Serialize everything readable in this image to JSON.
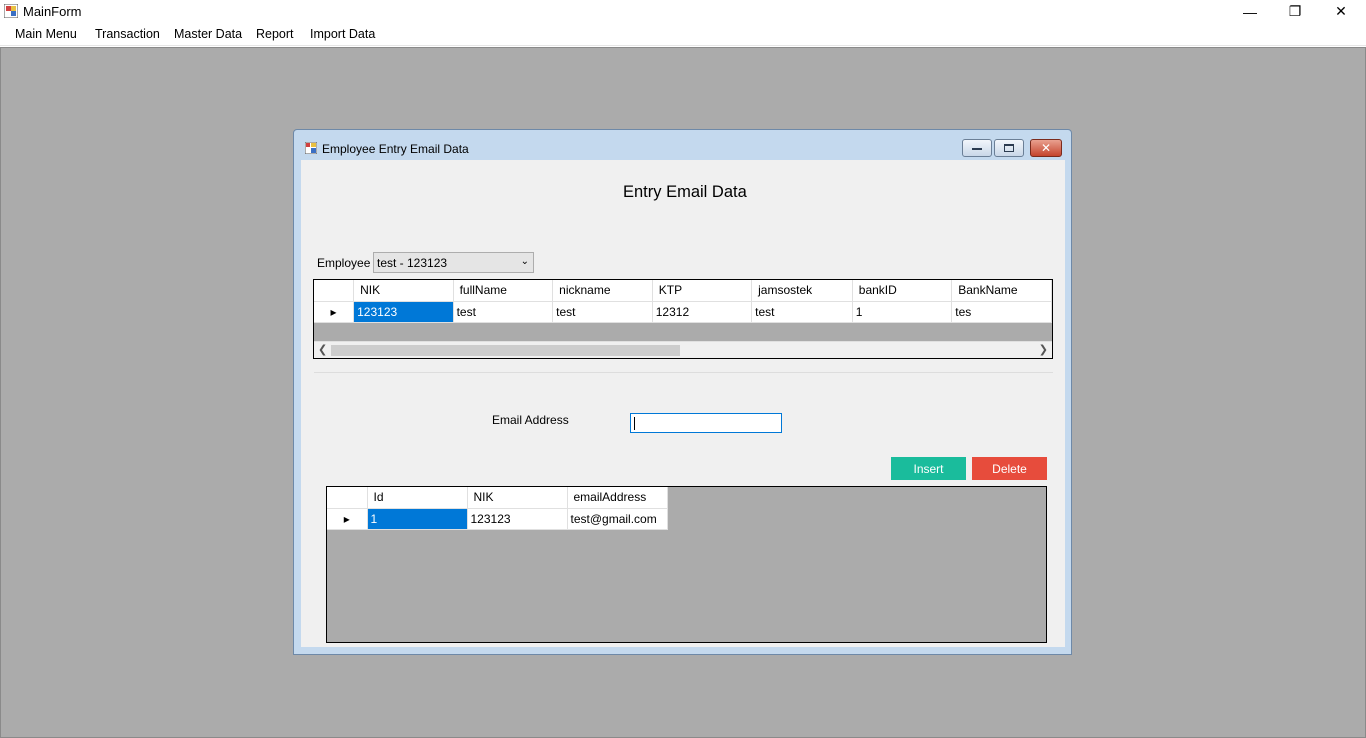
{
  "window": {
    "title": "MainForm",
    "controls": {
      "minimize": "—",
      "restore": "❐",
      "close": "✕"
    }
  },
  "menu": {
    "items": [
      "Main Menu",
      "Transaction",
      "Master Data",
      "Report",
      "Import Data"
    ]
  },
  "child": {
    "title": "Employee Entry Email Data",
    "heading": "Entry Email Data",
    "employee_label": "Employee",
    "employee_selected": "test - 123123",
    "employee_grid": {
      "columns": [
        "NIK",
        "fullName",
        "nickname",
        "KTP",
        "jamsostek",
        "bankID",
        "BankName"
      ],
      "rows": [
        [
          "123123",
          "test",
          "test",
          "12312",
          "test",
          "1",
          "tes"
        ]
      ]
    },
    "email_label": "Email Address",
    "email_value": "",
    "insert_label": "Insert",
    "delete_label": "Delete",
    "email_grid": {
      "columns": [
        "Id",
        "NIK",
        "emailAddress"
      ],
      "rows": [
        [
          "1",
          "123123",
          "test@gmail.com"
        ]
      ]
    }
  },
  "colors": {
    "insert": "#1abc9c",
    "delete": "#e74c3c",
    "selection": "#0078d7",
    "mdi_background": "#ababab"
  }
}
